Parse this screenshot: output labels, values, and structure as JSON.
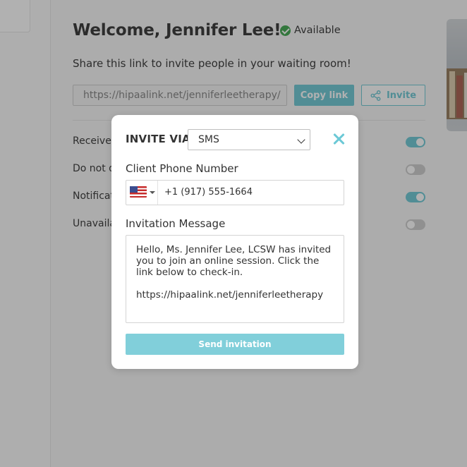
{
  "dashboard": {
    "welcome": "Welcome, Jennifer Lee!",
    "status": "Available",
    "share_text": "Share this link to invite people in your waiting room!",
    "link_value": "https://hipaalink.net/jenniferleetherapy/",
    "copy_label": "Copy link",
    "invite_label": "Invite",
    "settings": [
      {
        "label": "Receive v",
        "on": true
      },
      {
        "label": "Do not d",
        "on": false
      },
      {
        "label": "Notificat",
        "on": true
      },
      {
        "label": "Unavaila",
        "on": false
      }
    ]
  },
  "modal": {
    "invite_via_label": "INVITE VIA",
    "via_selected": "SMS",
    "phone_label": "Client Phone Number",
    "phone_value": "+1 (917) 555-1664",
    "message_label": "Invitation Message",
    "message_text": "Hello, Ms. Jennifer Lee, LCSW has invited you to join an online session. Click the link below to check-in.\n\nhttps://hipaalink.net/jenniferleetherapy",
    "send_label": "Send invitation"
  },
  "icons": {
    "status": "check-circle-icon",
    "share": "share-icon",
    "close": "close-icon",
    "flag": "us-flag-icon",
    "dropdown": "chevron-down-icon"
  },
  "colors": {
    "accent": "#5fc3d1",
    "send_button": "#81cfda",
    "status_green": "#2e9e3e"
  }
}
